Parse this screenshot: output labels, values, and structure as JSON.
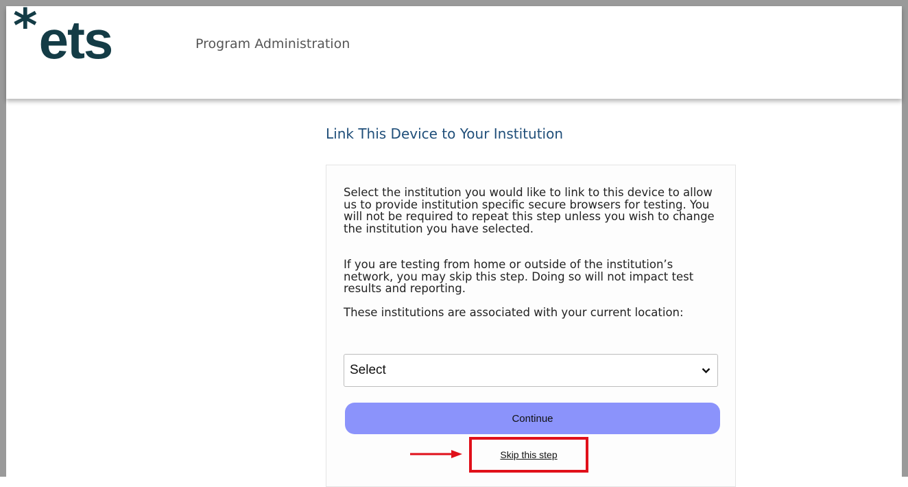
{
  "header": {
    "logo_star": "*",
    "logo_text": "ets",
    "program_title": "Program Administration"
  },
  "main": {
    "title": "Link This Device to Your Institution",
    "paragraphs": [
      "Select the institution you would like to link to this device to allow us to provide institution specific secure browsers for testing. You will not be required to repeat this step unless you wish to change the institution you have selected.",
      "If you are testing from home or outside of the institution’s network, you may skip this step. Doing so will not impact test results and reporting.",
      "These institutions are associated with your current location:"
    ],
    "select": {
      "value": "Select"
    },
    "continue_label": "Continue",
    "skip_label": "Skip this step"
  },
  "colors": {
    "logo": "#143c46",
    "title": "#1f4e79",
    "continue_button": "#8b93fb",
    "highlight": "#e0101a"
  },
  "icons": {
    "select_arrow": "chevron-down-icon",
    "annotation_arrow": "arrow-right-icon"
  }
}
